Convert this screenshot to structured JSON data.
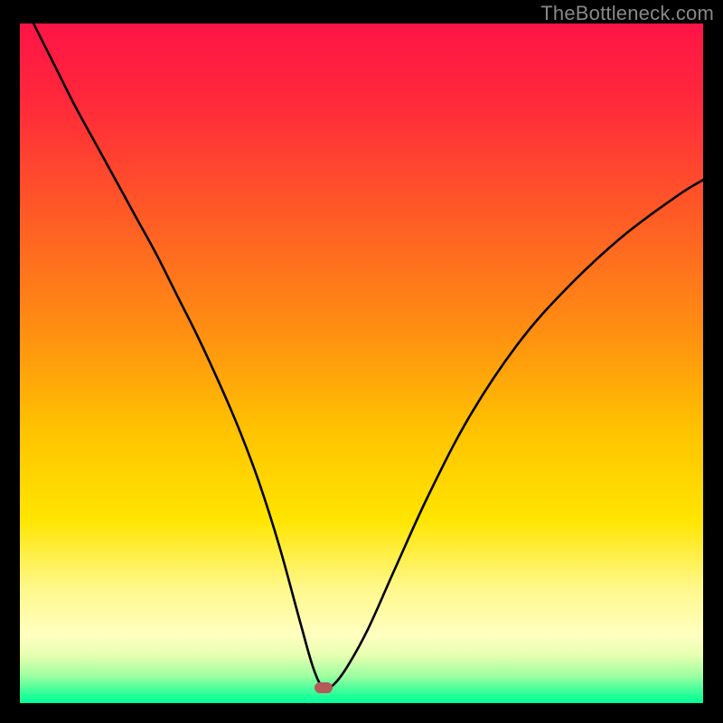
{
  "watermark": "TheBottleneck.com",
  "plot": {
    "width_units": 100,
    "height_units": 100,
    "gradient_stops": [
      {
        "offset": 0,
        "color": "#ff1446"
      },
      {
        "offset": 0.12,
        "color": "#ff2a3a"
      },
      {
        "offset": 0.28,
        "color": "#ff5a26"
      },
      {
        "offset": 0.45,
        "color": "#ff8e12"
      },
      {
        "offset": 0.6,
        "color": "#ffc300"
      },
      {
        "offset": 0.73,
        "color": "#ffe500"
      },
      {
        "offset": 0.83,
        "color": "#fff88a"
      },
      {
        "offset": 0.9,
        "color": "#ffffc0"
      },
      {
        "offset": 0.93,
        "color": "#e6ffb0"
      },
      {
        "offset": 0.96,
        "color": "#9dffa0"
      },
      {
        "offset": 0.985,
        "color": "#33ff99"
      },
      {
        "offset": 1.0,
        "color": "#00ff99"
      }
    ],
    "marker": {
      "x_percent": 44.5,
      "y_percent_from_top": 97.8,
      "color": "#b45a59"
    },
    "curve_stroke": "#000000"
  },
  "chart_data": {
    "type": "line",
    "title": "",
    "xlabel": "",
    "ylabel": "",
    "xlim": [
      0,
      100
    ],
    "ylim": [
      0,
      100
    ],
    "note": "V-shaped bottleneck curve. y = mismatch (lower is better). Minimum (green) near x≈44.5. Background gradient red→green maps to value.",
    "marker_point": {
      "x": 44.5,
      "y": 2.2
    },
    "series": [
      {
        "name": "bottleneck-curve",
        "x": [
          2,
          5,
          8,
          11,
          14,
          17,
          20,
          23,
          26,
          29,
          32,
          35,
          38,
          41,
          43,
          44.5,
          46,
          48,
          51,
          55,
          60,
          66,
          73,
          80,
          88,
          96,
          100
        ],
        "y": [
          100,
          94,
          88,
          82.5,
          77,
          71.5,
          66,
          60,
          54,
          47.5,
          40.5,
          32.5,
          23,
          12,
          5,
          2.2,
          2.8,
          5.5,
          11,
          20,
          31,
          42.5,
          53,
          61,
          68.5,
          74.5,
          77
        ]
      }
    ]
  }
}
